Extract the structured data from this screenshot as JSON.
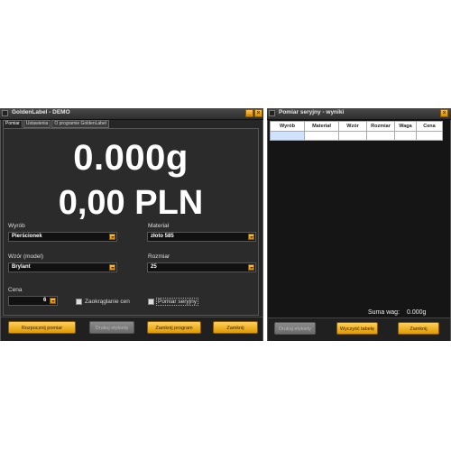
{
  "left_window": {
    "title": "GoldenLabel - DEMO",
    "tabs": [
      "Pomiar",
      "Ustawienia",
      "O programie GoldenLabel"
    ],
    "weight_display": "0.000g",
    "price_display": "0,00 PLN",
    "fields": {
      "wyrob": {
        "label": "Wyrób",
        "value": "Pierścionek"
      },
      "material": {
        "label": "Materiał",
        "value": "złoto 585"
      },
      "wzor": {
        "label": "Wzór (model)",
        "value": "Brylant"
      },
      "rozmiar": {
        "label": "Rozmiar",
        "value": "25"
      },
      "cena": {
        "label": "Cena",
        "value": "6"
      }
    },
    "checkboxes": {
      "zaokraglanie": {
        "label": "Zaokrąglanie cen",
        "checked": false
      },
      "pomiar_seryjny": {
        "label": "Pomiar seryjny",
        "checked": false
      }
    },
    "buttons": {
      "start": "Rozpocznij pomiar",
      "print": "Drukuj etykietę",
      "lock": "Zamknij program",
      "close": "Zamknij"
    }
  },
  "right_window": {
    "title": "Pomiar seryjny - wyniki",
    "table_headers": [
      "Wyrób",
      "Materiał",
      "Wzór",
      "Rozmiar",
      "Waga",
      "Cena"
    ],
    "sum_label": "Suma wag:",
    "sum_value": "0.000g",
    "buttons": {
      "print": "Drukuj etykiety",
      "clear": "Wyczyść tabelę",
      "close": "Zamknij"
    }
  },
  "colors": {
    "accent": "#f0a800",
    "window_bg": "#262626",
    "text": "#ffffff"
  }
}
